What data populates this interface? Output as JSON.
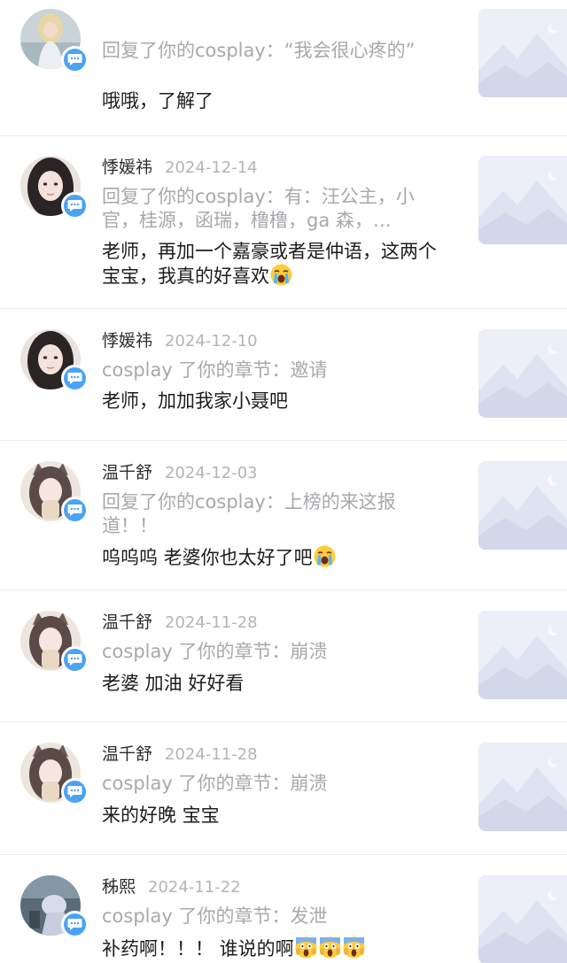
{
  "feed": {
    "items": [
      {
        "username": "",
        "date": "",
        "activity": "回复了你的cosplay：“我会很心疼的”",
        "message": "哦哦，了解了",
        "emojis": [],
        "avatar_icon": "blonde-figure-avatar",
        "thumbnail_icon": "mountain-placeholder-icon"
      },
      {
        "username": "悸媛祎",
        "date": "2024-12-14",
        "activity": "回复了你的cosplay：有：汪公主，小官，桂源，函瑞，橹橹，ga 森，…",
        "message": "老师，再加一个嘉豪或者是仲语，这两个宝宝，我真的好喜欢",
        "emojis": [
          "crying-face-emoji"
        ],
        "avatar_icon": "dark-hair-girl-avatar",
        "thumbnail_icon": "mountain-placeholder-icon"
      },
      {
        "username": "悸媛祎",
        "date": "2024-12-10",
        "activity": "cosplay 了你的章节：邀请",
        "message": "老师，加加我家小聂吧",
        "emojis": [],
        "avatar_icon": "dark-hair-girl-avatar",
        "thumbnail_icon": "mountain-placeholder-icon"
      },
      {
        "username": "温千舒",
        "date": "2024-12-03",
        "activity": "回复了你的cosplay：上榜的来这报道！！",
        "message": "呜呜呜 老婆你也太好了吧",
        "emojis": [
          "crying-face-emoji"
        ],
        "avatar_icon": "cat-ear-girl-avatar",
        "thumbnail_icon": "mountain-placeholder-icon"
      },
      {
        "username": "温千舒",
        "date": "2024-11-28",
        "activity": "cosplay 了你的章节：崩溃",
        "message": "老婆 加油 好好看",
        "emojis": [],
        "avatar_icon": "cat-ear-girl-avatar",
        "thumbnail_icon": "mountain-placeholder-icon"
      },
      {
        "username": "温千舒",
        "date": "2024-11-28",
        "activity": "cosplay 了你的章节：崩溃",
        "message": "来的好晚 宝宝",
        "emojis": [],
        "avatar_icon": "cat-ear-girl-avatar",
        "thumbnail_icon": "mountain-placeholder-icon"
      },
      {
        "username": "秭熙",
        "date": "2024-11-22",
        "activity": "cosplay 了你的章节：发泄",
        "message": "补药啊！！！ 谁说的啊",
        "emojis": [
          "screaming-face-emoji",
          "screaming-face-emoji",
          "screaming-face-emoji"
        ],
        "avatar_icon": "plush-figure-avatar",
        "thumbnail_icon": "mountain-placeholder-icon"
      }
    ]
  }
}
